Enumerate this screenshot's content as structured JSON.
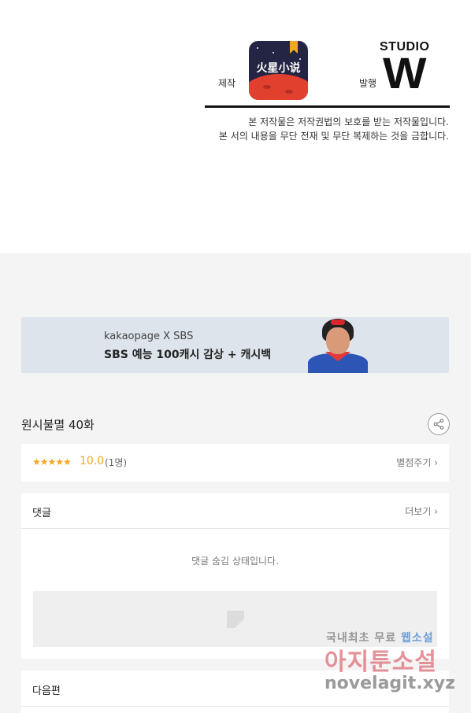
{
  "credits": {
    "production_label": "제작",
    "production_logo_text": "火星小说",
    "publisher_label": "발행",
    "publisher_logo_top": "STUDIO",
    "publisher_logo_letter": "W",
    "notice_line1": "본 저작물은 저작권법의 보호를 받는 저작물입니다.",
    "notice_line2": "본 서의 내용을 무단 전재 및 무단 복제하는 것을 금합니다."
  },
  "banner": {
    "line1": "kakaopage X SBS",
    "line2": "SBS 예능 100캐시 감상 + 캐시백"
  },
  "episode": {
    "title": "원시불멸 40화",
    "share_icon": "share-icon"
  },
  "rating": {
    "stars": "★★★★★",
    "score": "10.0",
    "count": "(1명)",
    "rate_link": "별점주기 ›"
  },
  "comments": {
    "title": "댓글",
    "more_link": "더보기 ›",
    "hidden_message": "댓글 숨김 상태입니다."
  },
  "next": {
    "title": "다음편"
  },
  "watermark": {
    "line1_a": "국내최초 무료",
    "line1_b": "웹소설",
    "line2": "아지툰소설",
    "line3": "novelagit.xyz"
  },
  "colors": {
    "accent_star": "#f5a623",
    "background_gray": "#f4f4f4",
    "banner_bg": "#dde4ec"
  }
}
